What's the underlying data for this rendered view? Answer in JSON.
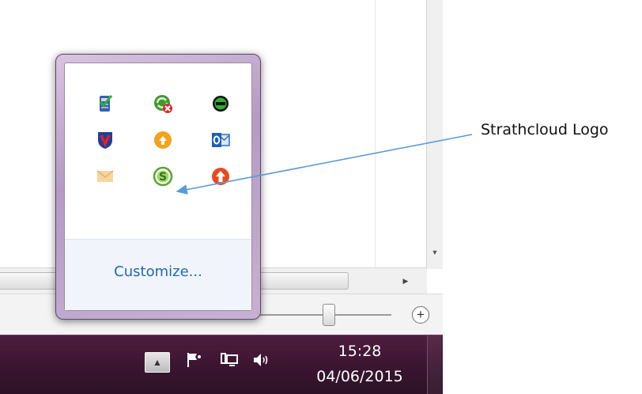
{
  "flyout": {
    "customize_label": "Customize...",
    "icons": [
      {
        "name": "security-check-icon"
      },
      {
        "name": "sync-error-icon"
      },
      {
        "name": "green-sync-icon"
      },
      {
        "name": "mcafee-shield-icon"
      },
      {
        "name": "orange-update-icon"
      },
      {
        "name": "outlook-icon"
      },
      {
        "name": "mail-envelope-icon"
      },
      {
        "name": "strathcloud-logo-icon"
      },
      {
        "name": "red-upload-icon"
      }
    ]
  },
  "taskbar": {
    "time": "15:28",
    "date": "04/06/2015",
    "icons": [
      "show-hidden-icons-arrow-icon",
      "action-center-flag-icon",
      "network-icon",
      "volume-icon"
    ]
  },
  "statusbar": {
    "zoom_in_icon": "plus-circle-icon"
  },
  "annotation": {
    "label": "Strathcloud Logo",
    "arrow_color": "#5b9bd5"
  },
  "colors": {
    "taskbar": "#3a1530",
    "flyout_frame": "#b59ac4",
    "link": "#1f67b7"
  }
}
